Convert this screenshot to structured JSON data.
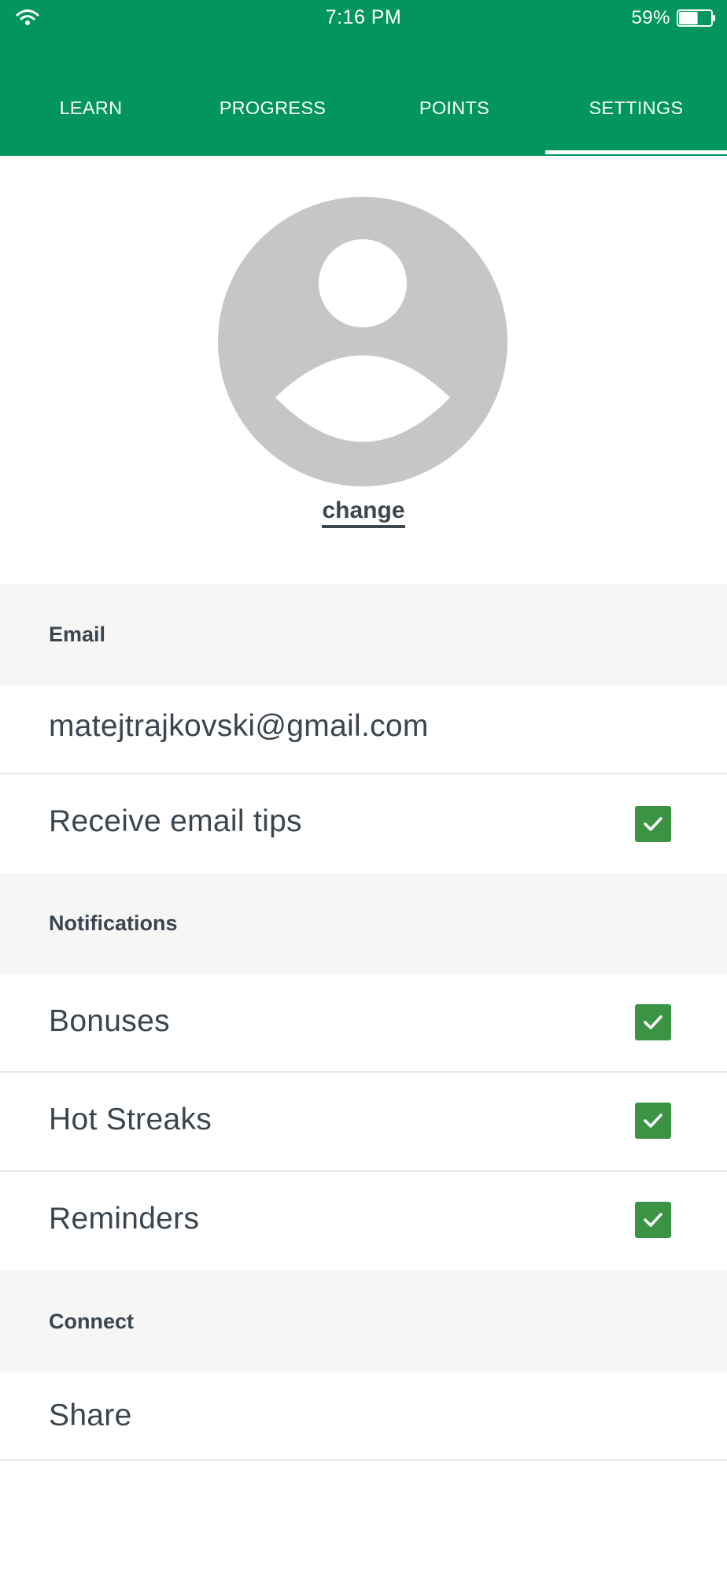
{
  "status_bar": {
    "time": "7:16 PM",
    "battery_percent": "59%",
    "battery_level": 0.59,
    "wifi_icon": "wifi-icon",
    "battery_icon": "battery-icon"
  },
  "tabs": [
    {
      "label": "LEARN",
      "active": false
    },
    {
      "label": "PROGRESS",
      "active": false
    },
    {
      "label": "POINTS",
      "active": false
    },
    {
      "label": "SETTINGS",
      "active": true
    }
  ],
  "profile": {
    "avatar_icon": "default-avatar-icon",
    "change_label": "change"
  },
  "sections": {
    "email": {
      "header": "Email",
      "address": "matejtrajkovski@gmail.com",
      "tips": {
        "label": "Receive email tips",
        "checked": true
      }
    },
    "notifications": {
      "header": "Notifications",
      "bonuses": {
        "label": "Bonuses",
        "checked": true
      },
      "hot_streaks": {
        "label": "Hot Streaks",
        "checked": true
      },
      "reminders": {
        "label": "Reminders",
        "checked": true
      }
    },
    "connect": {
      "header": "Connect",
      "share": {
        "label": "Share"
      }
    }
  },
  "colors": {
    "brand_green": "#02965e",
    "checkbox_green": "#3a9444",
    "section_bg": "#f6f6f6",
    "text": "#3a4550",
    "avatar_gray": "#c6c6c6"
  }
}
